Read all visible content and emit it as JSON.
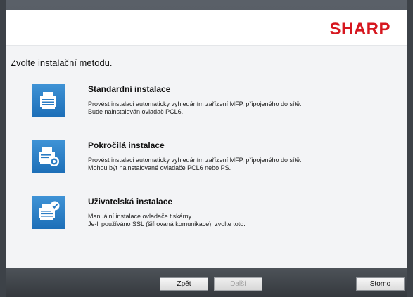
{
  "brand": {
    "logo_text": "SHARP",
    "logo_color": "#d6171f"
  },
  "page": {
    "heading": "Zvolte instalační metodu."
  },
  "options": [
    {
      "title": "Standardní instalace",
      "desc_line1": "Provést instalaci automaticky vyhledáním zařízení MFP, připojeného do sítě.",
      "desc_line2": "Bude nainstalován ovladač PCL6.",
      "icon": "printer-icon"
    },
    {
      "title": "Pokročilá instalace",
      "desc_line1": "Provést instalaci automaticky vyhledáním zařízení MFP, připojeného do sítě.",
      "desc_line2": "Mohou být nainstalované ovladače PCL6 nebo PS.",
      "icon": "printer-gear-icon"
    },
    {
      "title": "Uživatelská instalace",
      "desc_line1": "Manuální instalace ovladače tiskárny.",
      "desc_line2": "Je-li používáno SSL (šifrovaná komunikace), zvolte toto.",
      "icon": "printer-check-icon"
    }
  ],
  "footer": {
    "back_label": "Zpět",
    "next_label": "Další",
    "cancel_label": "Storno"
  },
  "colors": {
    "accent": "#1d6fb8"
  }
}
